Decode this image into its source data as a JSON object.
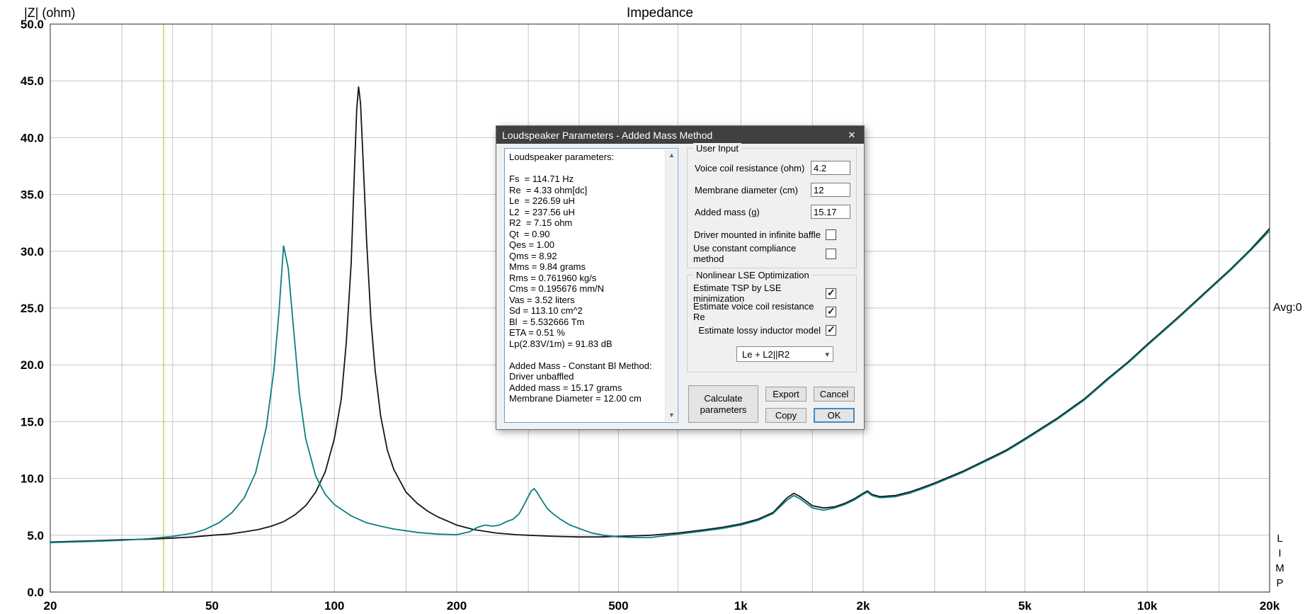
{
  "icons": {
    "close": "✕",
    "chevron_down": "▾",
    "scroll_up": "▲",
    "scroll_down": "▼",
    "checkmark": "✓"
  },
  "chart": {
    "title": "Impedance",
    "ylabel": "|Z| (ohm)",
    "avg_label": "Avg:0",
    "limp_label": "LIMP"
  },
  "chart_data": {
    "type": "line",
    "title": "Impedance",
    "ylabel": "|Z| (ohm)",
    "x_scale": "log",
    "xlim": [
      20,
      20000
    ],
    "ylim": [
      0,
      50
    ],
    "grid_on": true,
    "grid_color": "#c6c6c6",
    "frame_color": "#4a4a4a",
    "x_ticks": [
      {
        "label": "20",
        "value": 20
      },
      {
        "label": "50",
        "value": 50
      },
      {
        "label": "100",
        "value": 100
      },
      {
        "label": "200",
        "value": 200
      },
      {
        "label": "500",
        "value": 500
      },
      {
        "label": "1k",
        "value": 1000
      },
      {
        "label": "2k",
        "value": 2000
      },
      {
        "label": "5k",
        "value": 5000
      },
      {
        "label": "10k",
        "value": 10000
      },
      {
        "label": "20k",
        "value": 20000
      }
    ],
    "y_ticks": [
      {
        "label": "0.0",
        "value": 0
      },
      {
        "label": "5.0",
        "value": 5
      },
      {
        "label": "10.0",
        "value": 10
      },
      {
        "label": "15.0",
        "value": 15
      },
      {
        "label": "20.0",
        "value": 20
      },
      {
        "label": "25.0",
        "value": 25
      },
      {
        "label": "30.0",
        "value": 30
      },
      {
        "label": "35.0",
        "value": 35
      },
      {
        "label": "40.0",
        "value": 40
      },
      {
        "label": "45.0",
        "value": 45
      },
      {
        "label": "50.0",
        "value": 50
      }
    ],
    "x_gridlines": [
      30,
      40,
      50,
      70,
      100,
      150,
      200,
      300,
      400,
      500,
      700,
      1000,
      1500,
      2000,
      3000,
      4000,
      5000,
      7000,
      10000,
      15000,
      20000
    ],
    "cursor": {
      "freq": 38,
      "color": "#c8cc4e"
    },
    "series": [
      {
        "name": "impedance-curve-black",
        "color": "#161616",
        "points": [
          [
            20,
            4.4
          ],
          [
            25,
            4.5
          ],
          [
            30,
            4.6
          ],
          [
            35,
            4.65
          ],
          [
            40,
            4.75
          ],
          [
            45,
            4.85
          ],
          [
            50,
            5.0
          ],
          [
            55,
            5.1
          ],
          [
            60,
            5.3
          ],
          [
            65,
            5.5
          ],
          [
            70,
            5.8
          ],
          [
            75,
            6.2
          ],
          [
            80,
            6.8
          ],
          [
            85,
            7.6
          ],
          [
            90,
            8.8
          ],
          [
            95,
            10.6
          ],
          [
            100,
            13.5
          ],
          [
            104,
            17
          ],
          [
            107,
            22
          ],
          [
            110,
            29
          ],
          [
            112,
            37
          ],
          [
            113.5,
            42.5
          ],
          [
            114.7,
            44.5
          ],
          [
            116,
            43
          ],
          [
            118,
            37
          ],
          [
            120,
            31
          ],
          [
            123,
            24
          ],
          [
            126,
            19.5
          ],
          [
            130,
            15.5
          ],
          [
            135,
            12.5
          ],
          [
            140,
            10.8
          ],
          [
            150,
            8.8
          ],
          [
            160,
            7.8
          ],
          [
            170,
            7.1
          ],
          [
            180,
            6.6
          ],
          [
            200,
            5.9
          ],
          [
            220,
            5.5
          ],
          [
            250,
            5.2
          ],
          [
            280,
            5.05
          ],
          [
            300,
            5.0
          ],
          [
            350,
            4.9
          ],
          [
            400,
            4.85
          ],
          [
            450,
            4.85
          ],
          [
            500,
            4.9
          ],
          [
            600,
            5.0
          ],
          [
            700,
            5.2
          ],
          [
            800,
            5.45
          ],
          [
            900,
            5.7
          ],
          [
            1000,
            6.0
          ],
          [
            1100,
            6.4
          ],
          [
            1200,
            7.0
          ],
          [
            1300,
            8.3
          ],
          [
            1350,
            8.7
          ],
          [
            1400,
            8.4
          ],
          [
            1500,
            7.6
          ],
          [
            1600,
            7.4
          ],
          [
            1700,
            7.5
          ],
          [
            1800,
            7.8
          ],
          [
            1900,
            8.2
          ],
          [
            2000,
            8.7
          ],
          [
            2050,
            8.9
          ],
          [
            2100,
            8.6
          ],
          [
            2200,
            8.4
          ],
          [
            2400,
            8.5
          ],
          [
            2600,
            8.8
          ],
          [
            2800,
            9.2
          ],
          [
            3000,
            9.6
          ],
          [
            3500,
            10.6
          ],
          [
            4000,
            11.6
          ],
          [
            4500,
            12.5
          ],
          [
            5000,
            13.5
          ],
          [
            6000,
            15.3
          ],
          [
            7000,
            17.0
          ],
          [
            8000,
            18.8
          ],
          [
            9000,
            20.3
          ],
          [
            10000,
            21.8
          ],
          [
            12000,
            24.3
          ],
          [
            14000,
            26.5
          ],
          [
            16000,
            28.4
          ],
          [
            18000,
            30.2
          ],
          [
            20000,
            32.0
          ]
        ]
      },
      {
        "name": "impedance-curve-teal",
        "color": "#0b7e7e",
        "points": [
          [
            20,
            4.35
          ],
          [
            25,
            4.45
          ],
          [
            30,
            4.55
          ],
          [
            35,
            4.7
          ],
          [
            40,
            4.9
          ],
          [
            45,
            5.2
          ],
          [
            48,
            5.5
          ],
          [
            52,
            6.1
          ],
          [
            56,
            7.0
          ],
          [
            60,
            8.3
          ],
          [
            64,
            10.5
          ],
          [
            68,
            14.5
          ],
          [
            71,
            19.5
          ],
          [
            73,
            24.5
          ],
          [
            75,
            30.5
          ],
          [
            77,
            28.5
          ],
          [
            79,
            24
          ],
          [
            82,
            17.5
          ],
          [
            85,
            13.5
          ],
          [
            90,
            10.2
          ],
          [
            95,
            8.6
          ],
          [
            100,
            7.7
          ],
          [
            110,
            6.7
          ],
          [
            120,
            6.1
          ],
          [
            130,
            5.8
          ],
          [
            140,
            5.55
          ],
          [
            160,
            5.25
          ],
          [
            180,
            5.1
          ],
          [
            200,
            5.05
          ],
          [
            215,
            5.3
          ],
          [
            225,
            5.7
          ],
          [
            235,
            5.9
          ],
          [
            245,
            5.8
          ],
          [
            255,
            5.9
          ],
          [
            265,
            6.2
          ],
          [
            275,
            6.4
          ],
          [
            285,
            6.9
          ],
          [
            295,
            7.9
          ],
          [
            305,
            8.9
          ],
          [
            310,
            9.1
          ],
          [
            315,
            8.8
          ],
          [
            325,
            8.0
          ],
          [
            335,
            7.3
          ],
          [
            345,
            6.9
          ],
          [
            360,
            6.4
          ],
          [
            380,
            5.9
          ],
          [
            400,
            5.6
          ],
          [
            430,
            5.2
          ],
          [
            460,
            5.0
          ],
          [
            500,
            4.85
          ],
          [
            550,
            4.8
          ],
          [
            600,
            4.8
          ],
          [
            700,
            5.1
          ],
          [
            800,
            5.35
          ],
          [
            900,
            5.6
          ],
          [
            1000,
            5.9
          ],
          [
            1100,
            6.3
          ],
          [
            1200,
            6.9
          ],
          [
            1300,
            8.1
          ],
          [
            1350,
            8.5
          ],
          [
            1400,
            8.2
          ],
          [
            1500,
            7.4
          ],
          [
            1600,
            7.2
          ],
          [
            1700,
            7.4
          ],
          [
            1800,
            7.7
          ],
          [
            1900,
            8.1
          ],
          [
            2000,
            8.6
          ],
          [
            2050,
            8.8
          ],
          [
            2100,
            8.5
          ],
          [
            2200,
            8.3
          ],
          [
            2400,
            8.4
          ],
          [
            2600,
            8.7
          ],
          [
            2800,
            9.1
          ],
          [
            3000,
            9.5
          ],
          [
            3500,
            10.5
          ],
          [
            4000,
            11.5
          ],
          [
            4500,
            12.4
          ],
          [
            5000,
            13.4
          ],
          [
            6000,
            15.2
          ],
          [
            7000,
            16.9
          ],
          [
            8000,
            18.7
          ],
          [
            9000,
            20.2
          ],
          [
            10000,
            21.7
          ],
          [
            12000,
            24.2
          ],
          [
            14000,
            26.4
          ],
          [
            16000,
            28.3
          ],
          [
            18000,
            30.1
          ],
          [
            20000,
            31.8
          ]
        ]
      }
    ]
  },
  "dialog": {
    "title": "Loudspeaker Parameters - Added Mass Method",
    "parameters_text": "Loudspeaker parameters:\n\nFs  = 114.71 Hz\nRe  = 4.33 ohm[dc]\nLe  = 226.59 uH\nL2  = 237.56 uH\nR2  = 7.15 ohm\nQt  = 0.90\nQes = 1.00\nQms = 8.92\nMms = 9.84 grams\nRms = 0.761960 kg/s\nCms = 0.195676 mm/N\nVas = 3.52 liters\nSd = 113.10 cm^2\nBl  = 5.532666 Tm\nETA = 0.51 %\nLp(2.83V/1m) = 91.83 dB\n\nAdded Mass - Constant Bl Method:\nDriver unbaffled\nAdded mass = 15.17 grams\nMembrane Diameter = 12.00 cm",
    "user_input": {
      "title": "User Input",
      "fields": [
        {
          "label": "Voice coil resistance (ohm)",
          "value": "4.2"
        },
        {
          "label": "Membrane diameter (cm)",
          "value": "12"
        },
        {
          "label": "Added mass (g)",
          "value": "15.17"
        }
      ],
      "checkboxes": [
        {
          "label": "Driver mounted in infinite baffle",
          "checked": false
        },
        {
          "label": "Use constant compliance method",
          "checked": false
        }
      ]
    },
    "lse": {
      "title": "Nonlinear LSE Optimization",
      "checkboxes": [
        {
          "label": "Estimate TSP by LSE minimization",
          "checked": true
        },
        {
          "label": "Estimate voice coil resistance Re",
          "checked": true
        },
        {
          "label": "Estimate lossy inductor model",
          "checked": true
        }
      ],
      "dropdown": {
        "value": "Le + L2||R2"
      }
    },
    "buttons": {
      "calculate": "Calculate parameters",
      "export": "Export",
      "cancel": "Cancel",
      "copy": "Copy",
      "ok": "OK"
    }
  }
}
